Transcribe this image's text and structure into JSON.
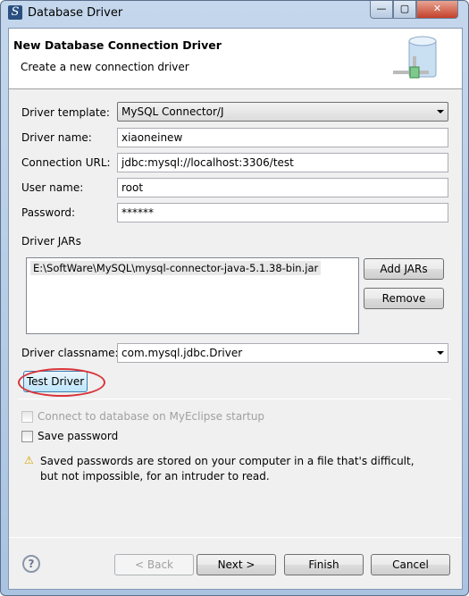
{
  "window": {
    "title": "Database Driver",
    "minimize": "—",
    "maximize": "▢",
    "close": "✕"
  },
  "header": {
    "title": "New Database Connection Driver",
    "subtitle": "Create a new connection driver",
    "icon": "database-connection-icon"
  },
  "form": {
    "template_label": "Driver template:",
    "template_value": "MySQL Connector/J",
    "name_label": "Driver name:",
    "name_value": "xiaoneinew",
    "url_label": "Connection URL:",
    "url_value": "jdbc:mysql://localhost:3306/test",
    "user_label": "User name:",
    "user_value": "root",
    "password_label": "Password:",
    "password_value": "******",
    "jars_label": "Driver JARs",
    "jars": [
      "E:\\SoftWare\\MySQL\\mysql-connector-java-5.1.38-bin.jar"
    ],
    "add_jars": "Add JARs",
    "remove": "Remove",
    "classname_label": "Driver classname:",
    "classname_value": "com.mysql.jdbc.Driver",
    "test_driver": "Test Driver",
    "connect_startup": "Connect to database on MyEclipse startup",
    "save_password": "Save password",
    "warning": "Saved passwords are stored on your computer in a file that's difficult, but not impossible, for an intruder to read."
  },
  "footer": {
    "help": "?",
    "back": "< Back",
    "next": "Next >",
    "finish": "Finish",
    "cancel": "Cancel"
  },
  "colors": {
    "highlight_circle": "#d9343a"
  }
}
